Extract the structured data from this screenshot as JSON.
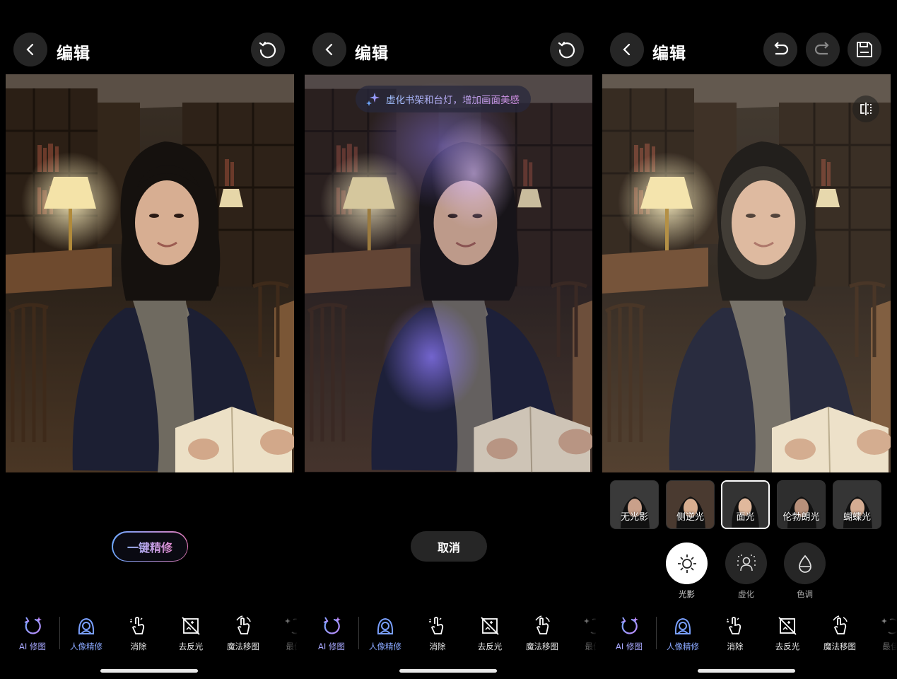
{
  "panels": [
    {
      "title": "编辑",
      "action_label": "一键精修"
    },
    {
      "title": "编辑",
      "suggestion": "虚化书架和台灯，增加画面美感",
      "cancel_label": "取消"
    },
    {
      "title": "编辑",
      "presets": [
        "无光影",
        "侧逆光",
        "面光",
        "伦勃朗光",
        "蝴蝶光"
      ],
      "selected_preset": "面光",
      "modes": [
        "光影",
        "虚化",
        "色调"
      ],
      "selected_mode": "光影"
    }
  ],
  "tools": [
    {
      "label": "AI 修图",
      "icon": "ai-retouch-icon"
    },
    {
      "label": "人像精修",
      "icon": "portrait-icon"
    },
    {
      "label": "消除",
      "icon": "eraser-icon"
    },
    {
      "label": "去反光",
      "icon": "anti-reflection-icon"
    },
    {
      "label": "魔法移图",
      "icon": "magic-move-icon"
    },
    {
      "label": "最佳",
      "icon": "best-shot-icon"
    }
  ],
  "active_tool": "人像精修",
  "colors": {
    "accent": "#8aa8ff",
    "ai": "#a8a8ff",
    "button_bg": "#262626"
  }
}
